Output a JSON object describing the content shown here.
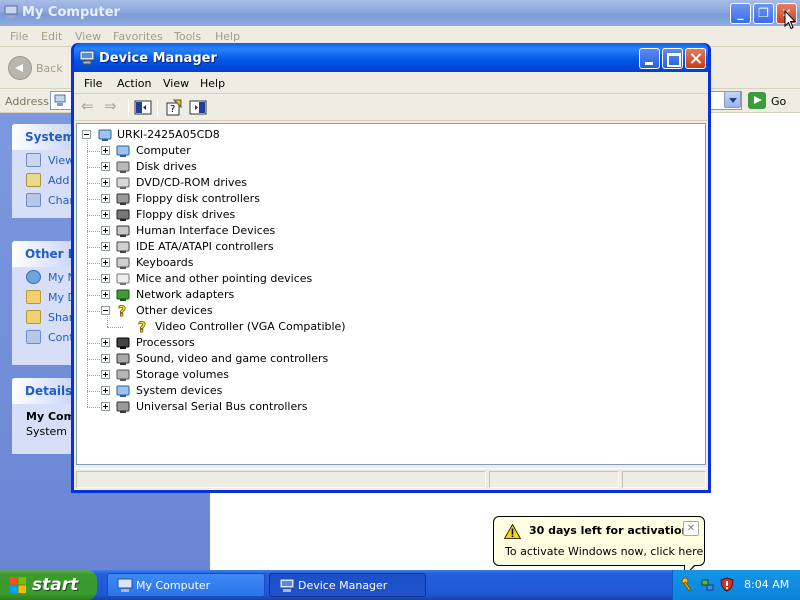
{
  "my_computer": {
    "title": "My Computer",
    "menu": [
      "File",
      "Edit",
      "View",
      "Favorites",
      "Tools",
      "Help"
    ],
    "back_label": "Back",
    "address_label": "Address",
    "go_label": "Go",
    "left_pane": {
      "system_tasks": {
        "header": "System",
        "items": [
          "View",
          "Add",
          "Chan"
        ]
      },
      "other_places": {
        "header": "Other Pl",
        "items": [
          "My N",
          "My D",
          "Shar",
          "Cont"
        ]
      },
      "details": {
        "header": "Details",
        "lines": [
          "My Com",
          "System F"
        ]
      }
    }
  },
  "device_manager": {
    "title": "Device Manager",
    "menu": [
      "File",
      "Action",
      "View",
      "Help"
    ],
    "tree": {
      "root": "URKI-2425A05CD8",
      "items": [
        {
          "label": "Computer",
          "icon": "computer-icon",
          "expanded": false
        },
        {
          "label": "Disk drives",
          "icon": "disk-drive-icon",
          "expanded": false
        },
        {
          "label": "DVD/CD-ROM drives",
          "icon": "cdrom-icon",
          "expanded": false
        },
        {
          "label": "Floppy disk controllers",
          "icon": "floppy-controller-icon",
          "expanded": false
        },
        {
          "label": "Floppy disk drives",
          "icon": "floppy-drive-icon",
          "expanded": false
        },
        {
          "label": "Human Interface Devices",
          "icon": "hid-icon",
          "expanded": false
        },
        {
          "label": "IDE ATA/ATAPI controllers",
          "icon": "ide-controller-icon",
          "expanded": false
        },
        {
          "label": "Keyboards",
          "icon": "keyboard-icon",
          "expanded": false
        },
        {
          "label": "Mice and other pointing devices",
          "icon": "mouse-icon",
          "expanded": false
        },
        {
          "label": "Network adapters",
          "icon": "network-adapter-icon",
          "expanded": false
        },
        {
          "label": "Other devices",
          "icon": "unknown-device-icon",
          "expanded": true,
          "children": [
            {
              "label": "Video Controller (VGA Compatible)",
              "icon": "unknown-device-icon"
            }
          ]
        },
        {
          "label": "Processors",
          "icon": "processor-icon",
          "expanded": false
        },
        {
          "label": "Sound, video and game controllers",
          "icon": "sound-icon",
          "expanded": false
        },
        {
          "label": "Storage volumes",
          "icon": "storage-volume-icon",
          "expanded": false
        },
        {
          "label": "System devices",
          "icon": "system-device-icon",
          "expanded": false
        },
        {
          "label": "Universal Serial Bus controllers",
          "icon": "usb-icon",
          "expanded": false
        }
      ]
    }
  },
  "balloon": {
    "title": "30 days left for activation",
    "text": "To activate Windows now, click here",
    "close_glyph": "✕"
  },
  "taskbar": {
    "start_label": "start",
    "tasks": [
      {
        "label": "My Computer"
      },
      {
        "label": "Device Manager"
      }
    ],
    "clock": "8:04 AM"
  },
  "colors": {
    "xp_blue": "#0831d9",
    "taskbar_blue": "#245edb",
    "start_green": "#3c9a2e",
    "balloon_yellow": "#ffffe1",
    "link_blue": "#215dc6"
  }
}
